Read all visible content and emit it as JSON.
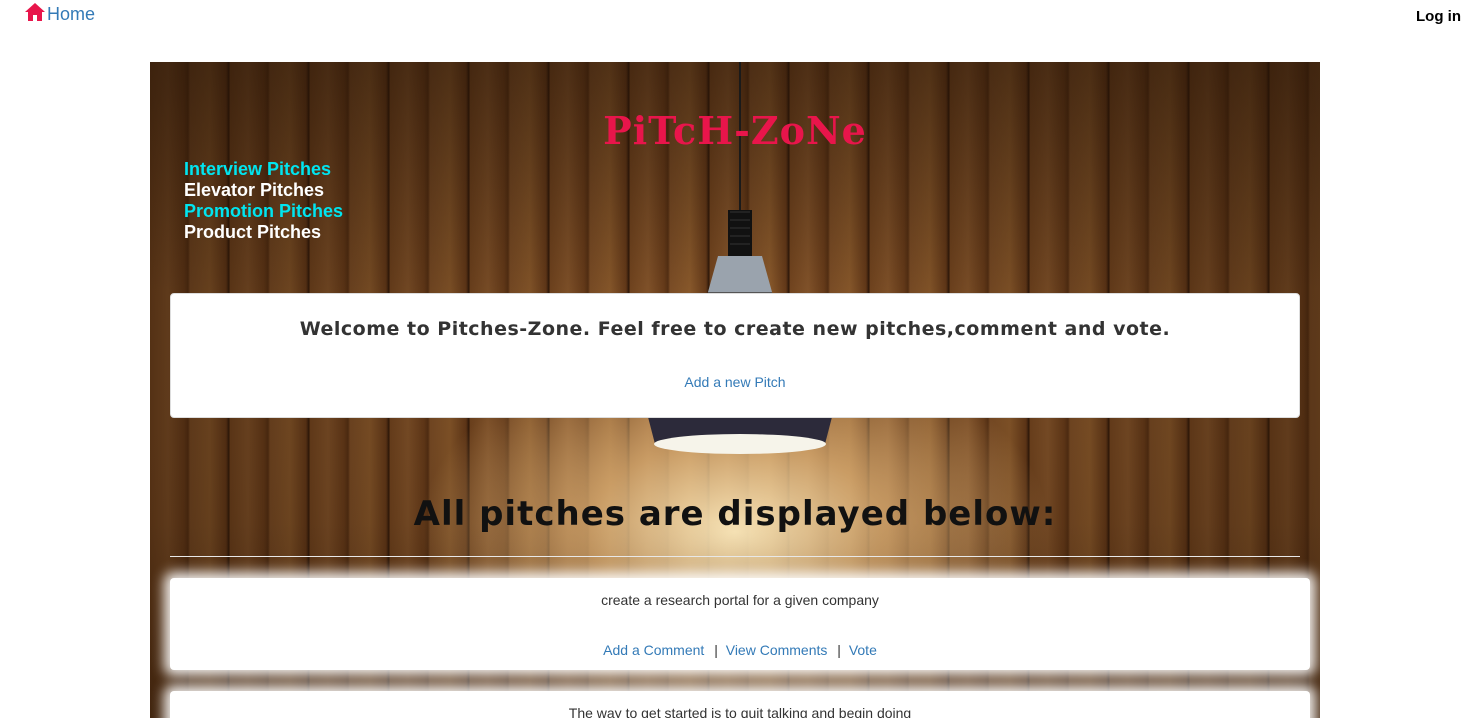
{
  "nav": {
    "home_label": "Home",
    "login_label": "Log in"
  },
  "hero": {
    "title": "PiTcH-ZoNe",
    "categories": [
      {
        "label": "Interview Pitches",
        "color": "#00e5f0"
      },
      {
        "label": "Elevator Pitches",
        "color": "#ffffff"
      },
      {
        "label": "Promotion Pitches",
        "color": "#00e5f0"
      },
      {
        "label": "Product Pitches",
        "color": "#ffffff"
      }
    ]
  },
  "welcome": {
    "text": "Welcome to Pitches-Zone. Feel free to create new pitches,comment and vote.",
    "add_pitch_label": "Add a new Pitch"
  },
  "pitches_section": {
    "heading": "All pitches are displayed below:",
    "separator": "|",
    "pitches": [
      {
        "text": "create a research portal for a given company",
        "add_comment": "Add a Comment",
        "view_comments": "View Comments",
        "vote": "Vote"
      },
      {
        "text": "The way to get started is to quit talking and begin doing"
      }
    ]
  },
  "colors": {
    "link": "#337ab7",
    "title": "#e8154b",
    "home_icon": "#e8154b"
  },
  "icons": {
    "home": "home-icon"
  }
}
